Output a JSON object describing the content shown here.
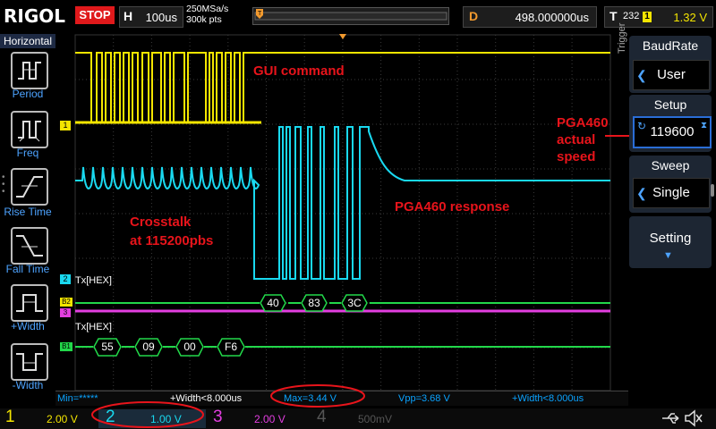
{
  "topbar": {
    "logo": "RIGOL",
    "run_state": "STOP",
    "timebase_key": "H",
    "timebase_value": "100us",
    "sample_rate": "250MSa/s",
    "memory_depth": "300k pts",
    "delay_key": "D",
    "delay_value": "498.000000us",
    "trigger_key": "T",
    "trigger_status": "232",
    "trigger_source": "1",
    "trigger_level": "1.32 V"
  },
  "left_panel": {
    "title": "Horizontal",
    "items": [
      {
        "label": "Period",
        "icon": "period-icon"
      },
      {
        "label": "Freq",
        "icon": "freq-icon"
      },
      {
        "label": "Rise Time",
        "icon": "rise-time-icon"
      },
      {
        "label": "Fall Time",
        "icon": "fall-time-icon"
      },
      {
        "label": "+Width",
        "icon": "pos-width-icon"
      },
      {
        "label": "-Width",
        "icon": "neg-width-icon"
      }
    ]
  },
  "right_panel": {
    "side_label": "Trigger",
    "baudrate_title": "BaudRate",
    "baudrate_value": "User",
    "setup_title": "Setup",
    "setup_value": "119600",
    "sweep_title": "Sweep",
    "sweep_value": "Single",
    "setting_label": "Setting"
  },
  "screen": {
    "annotations": {
      "gui_command": "GUI command",
      "crosstalk_line1": "Crosstalk",
      "crosstalk_line2": "at 115200pbs",
      "pga_response": "PGA460 response",
      "pga_actual_1": "PGA460",
      "pga_actual_2": "actual",
      "pga_actual_3": "speed"
    },
    "markers": {
      "ch1": "1",
      "ch2": "2",
      "b2": "B2",
      "ch3": "3",
      "b1": "B1"
    },
    "decode_b2_label": "Tx[HEX]",
    "decode_b1_label": "Tx[HEX]",
    "b2_bytes": [
      "40",
      "83",
      "3C"
    ],
    "b1_bytes": [
      "55",
      "09",
      "00",
      "F6"
    ]
  },
  "measurements": {
    "min": "Min=*****",
    "pwidth1": "+Width<8.000us",
    "max": "Max=3.44 V",
    "vpp": "Vpp=3.68 V",
    "pwidth2": "+Width<8.000us"
  },
  "channels": [
    {
      "num": "1",
      "scale": "2.00 V",
      "color": "#f4e500"
    },
    {
      "num": "2",
      "scale": "1.00 V",
      "color": "#19d9f0"
    },
    {
      "num": "3",
      "scale": "2.00 V",
      "color": "#e33ee0"
    },
    {
      "num": "4",
      "scale": "500mV",
      "color": "#555555"
    }
  ],
  "colors": {
    "ch1": "#f4e500",
    "ch2": "#19d9f0",
    "ch3": "#e33ee0",
    "bus": "#22d84a",
    "annotation": "#e8141b",
    "stop": "#e0191b"
  }
}
